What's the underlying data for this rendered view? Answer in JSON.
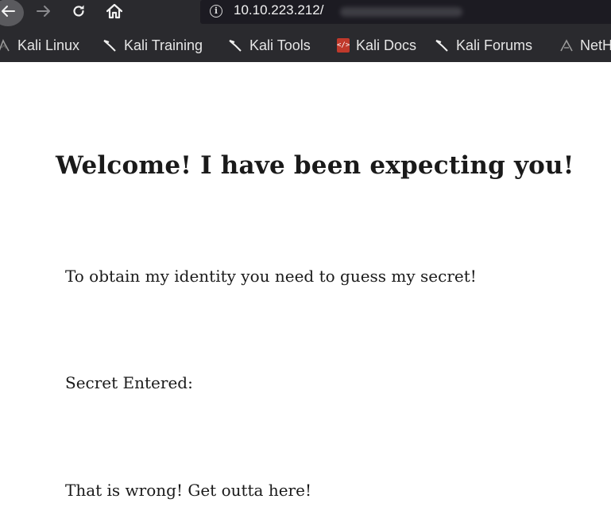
{
  "browser": {
    "url": "10.10.223.212/",
    "bookmarks": [
      {
        "label": "Kali Linux",
        "icon": "kali-dragon-icon"
      },
      {
        "label": "Kali Training",
        "icon": "kali-dragon-icon"
      },
      {
        "label": "Kali Tools",
        "icon": "kali-dragon-icon"
      },
      {
        "label": "Kali Docs",
        "icon": "kali-docs-icon"
      },
      {
        "label": "Kali Forums",
        "icon": "kali-dragon-icon"
      },
      {
        "label": "NetH",
        "icon": "nethunter-icon"
      }
    ]
  },
  "page": {
    "heading": "Welcome! I have been expecting you!",
    "intro": "To obtain my identity you need to guess my secret!",
    "secret_label": "Secret Entered:",
    "result": "That is wrong! Get outta here!"
  },
  "colors": {
    "chrome_background": "#2a2a2e",
    "url_bar_background": "#1c1b22",
    "page_background": "#ffffff",
    "text": "#1a1a1a"
  }
}
